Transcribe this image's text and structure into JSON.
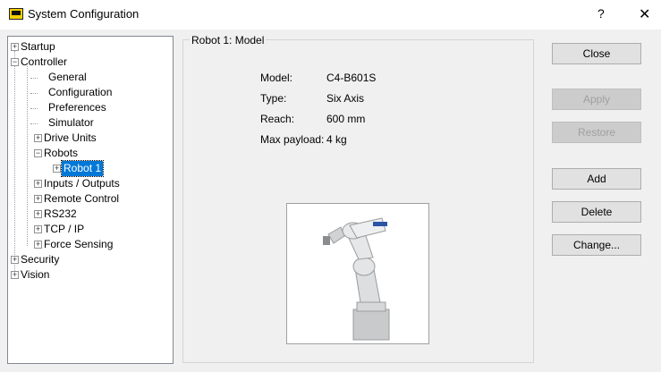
{
  "window": {
    "title": "System Configuration",
    "help_glyph": "?",
    "close_glyph": "✕"
  },
  "tree": {
    "startup": "Startup",
    "controller": "Controller",
    "general": "General",
    "configuration": "Configuration",
    "preferences": "Preferences",
    "simulator": "Simulator",
    "drive_units": "Drive Units",
    "robots": "Robots",
    "robot1": "Robot 1",
    "inputs_outputs": "Inputs / Outputs",
    "remote_control": "Remote Control",
    "rs232": "RS232",
    "tcp_ip": "TCP / IP",
    "force_sensing": "Force Sensing",
    "security": "Security",
    "vision": "Vision",
    "plus": "+",
    "minus": "−"
  },
  "panel": {
    "group_title": "Robot 1: Model",
    "properties": [
      {
        "key": "Model:",
        "value": "C4-B601S"
      },
      {
        "key": "Type:",
        "value": "Six Axis"
      },
      {
        "key": "Reach:",
        "value": "600 mm"
      },
      {
        "key": "Max payload:",
        "value": "4 kg"
      }
    ],
    "robot_brand": "EPSON"
  },
  "buttons": {
    "close": "Close",
    "apply": "Apply",
    "restore": "Restore",
    "add": "Add",
    "delete": "Delete",
    "change": "Change..."
  },
  "colors": {
    "selection": "#0078d7",
    "disabled_text": "#a0a0a0"
  }
}
